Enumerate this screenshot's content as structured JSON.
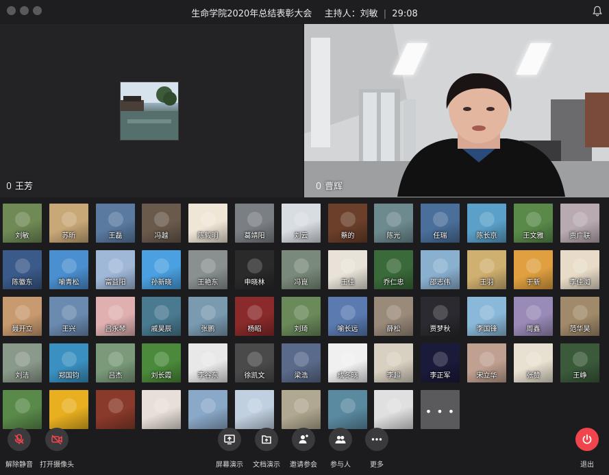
{
  "window": {
    "title": "生命学院2020年总结表彰大会",
    "host": "主持人：刘敏",
    "elapsed": "29:08"
  },
  "videos": [
    {
      "name": "王芳"
    },
    {
      "name": "曹辉"
    }
  ],
  "participants": [
    {
      "name": "刘敏",
      "color": "#6f8a55"
    },
    {
      "name": "苏昕",
      "color": "#c9a878"
    },
    {
      "name": "王磊",
      "color": "#5a7aa0"
    },
    {
      "name": "冯越",
      "color": "#6a5a4c"
    },
    {
      "name": "陈毅明",
      "color": "#efe6d6"
    },
    {
      "name": "葛靖阳",
      "color": "#7a7f84"
    },
    {
      "name": "刘云",
      "color": "#d8dde2"
    },
    {
      "name": "蔡的",
      "color": "#6b3f2a"
    },
    {
      "name": "陈光",
      "color": "#6d8a8f"
    },
    {
      "name": "任瑞",
      "color": "#4a6f9a"
    },
    {
      "name": "陈长京",
      "color": "#5aa0c8"
    },
    {
      "name": "王文雅",
      "color": "#5a8a4a"
    },
    {
      "name": "贾广联",
      "color": "#b8aab0"
    },
    {
      "name": "陈徽东",
      "color": "#3a5a8a"
    },
    {
      "name": "喻青松",
      "color": "#4a8fd0"
    },
    {
      "name": "富益阳",
      "color": "#a0b8d8"
    },
    {
      "name": "孙新晓",
      "color": "#4aa0e0"
    },
    {
      "name": "王艳东",
      "color": "#8a9090"
    },
    {
      "name": "申晓林",
      "color": "#2a2a2a"
    },
    {
      "name": "冯崑",
      "color": "#7a8a7a"
    },
    {
      "name": "王佳",
      "color": "#e8e2d8"
    },
    {
      "name": "乔仁忠",
      "color": "#3a6a3a"
    },
    {
      "name": "邵志伟",
      "color": "#8ab0d0"
    },
    {
      "name": "王羽",
      "color": "#d0b070"
    },
    {
      "name": "于新",
      "color": "#e0a040"
    },
    {
      "name": "李佳洳",
      "color": "#e8dcc8"
    },
    {
      "name": "聂开立",
      "color": "#c89a70"
    },
    {
      "name": "王兴",
      "color": "#6a8ab0"
    },
    {
      "name": "吕永琴",
      "color": "#e0b0b0"
    },
    {
      "name": "戚昊辰",
      "color": "#4a7a90"
    },
    {
      "name": "张鹏",
      "color": "#7a9ab0"
    },
    {
      "name": "杨昭",
      "color": "#8a2a2a"
    },
    {
      "name": "刘琦",
      "color": "#6a8a5a"
    },
    {
      "name": "喻长远",
      "color": "#5a7ab0"
    },
    {
      "name": "薛松",
      "color": "#9a8a7a"
    },
    {
      "name": "贾梦秋",
      "color": "#2a2a30"
    },
    {
      "name": "李国锋",
      "color": "#8ab8d8"
    },
    {
      "name": "周鑫",
      "color": "#9a8ab8"
    },
    {
      "name": "范华昊",
      "color": "#a08a6a"
    },
    {
      "name": "刘洁",
      "color": "#8a9a8a"
    },
    {
      "name": "郑国钧",
      "color": "#3a90c0"
    },
    {
      "name": "吕杰",
      "color": "#7a9a7a"
    },
    {
      "name": "刘长霞",
      "color": "#4a8a3a"
    },
    {
      "name": "李谷东",
      "color": "#e8e8e8"
    },
    {
      "name": "徐凯文",
      "color": "#4a4a4a"
    },
    {
      "name": "梁浩",
      "color": "#5a6a8a"
    },
    {
      "name": "成冬晓",
      "color": "#f0f0f0"
    },
    {
      "name": "李超",
      "color": "#d8d0c0"
    },
    {
      "name": "李正军",
      "color": "#1a1a3a"
    },
    {
      "name": "宋立华",
      "color": "#c0a090"
    },
    {
      "name": "张赞",
      "color": "#e8e0d0"
    },
    {
      "name": "王峥",
      "color": "#3a5a3a"
    },
    {
      "name": "",
      "color": "#5a8a4a"
    },
    {
      "name": "",
      "color": "#e8b020"
    },
    {
      "name": "",
      "color": "#8a3a2a"
    },
    {
      "name": "",
      "color": "#e8e0d8"
    },
    {
      "name": "",
      "color": "#8aa8c8"
    },
    {
      "name": "",
      "color": "#c0d0e0"
    },
    {
      "name": "",
      "color": "#b0a890"
    },
    {
      "name": "",
      "color": "#5a8aa0"
    },
    {
      "name": "",
      "color": "#e0e0e0"
    }
  ],
  "more_label": "• • •",
  "more_color": "#5a5a5c",
  "toolbar": {
    "unmute": "解除静音",
    "camera": "打开摄像头",
    "share_screen": "屏幕演示",
    "share_doc": "文档演示",
    "invite": "邀请参会",
    "participants": "参与人",
    "more": "更多",
    "leave": "退出"
  },
  "colors": {
    "leave": "#f0454c",
    "button": "#3a3a3c"
  }
}
